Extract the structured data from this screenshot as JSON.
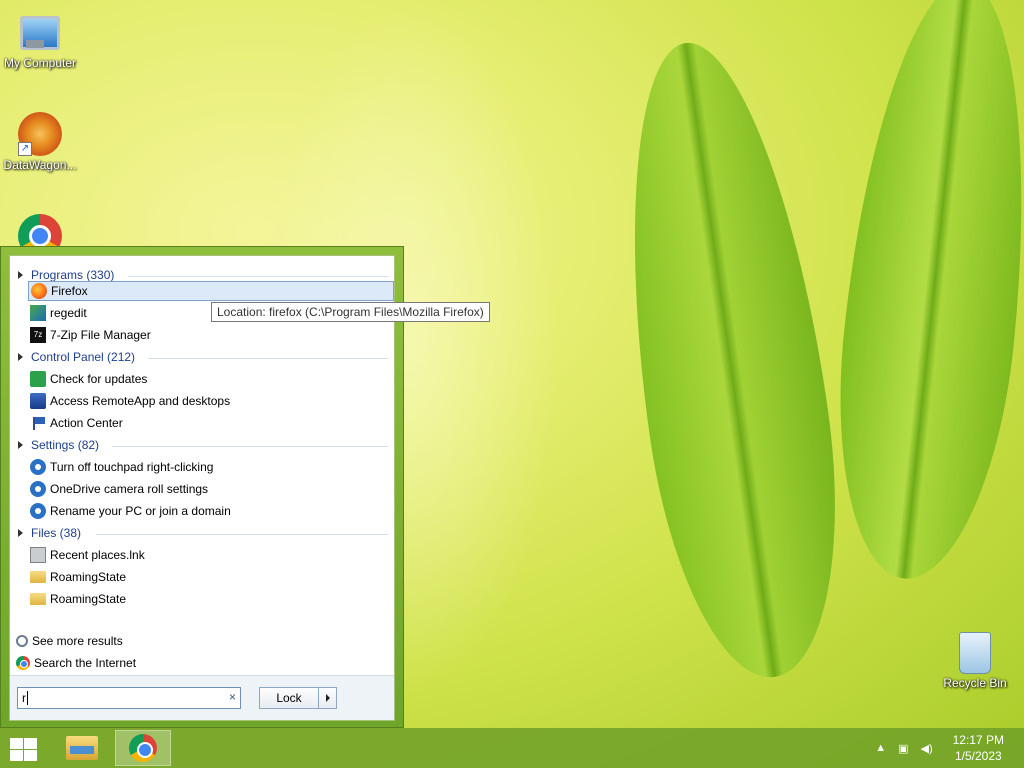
{
  "desktop": {
    "icons": [
      {
        "label": "My Computer"
      },
      {
        "label": "DataWagon..."
      },
      {
        "label": "Recycle Bin"
      }
    ]
  },
  "start_menu": {
    "groups": [
      {
        "label": "Programs (330)",
        "items": [
          "Firefox",
          "regedit",
          "7-Zip File Manager"
        ]
      },
      {
        "label": "Control Panel (212)",
        "items": [
          "Check for updates",
          "Access RemoteApp and desktops",
          "Action Center"
        ]
      },
      {
        "label": "Settings (82)",
        "items": [
          "Turn off touchpad right-clicking",
          "OneDrive camera roll settings",
          "Rename your PC or join a domain"
        ]
      },
      {
        "label": "Files (38)",
        "items": [
          "Recent places.lnk",
          "RoamingState",
          "RoamingState"
        ]
      }
    ],
    "zip_badge": "7z",
    "see_more": "See more results",
    "search_internet": "Search the Internet",
    "search_value": "r",
    "clear_icon": "×",
    "lock_label": "Lock"
  },
  "tooltip": "Location: firefox (C:\\Program Files\\Mozilla Firefox)",
  "taskbar": {
    "time": "12:17 PM",
    "date": "1/5/2023",
    "tray_up": "▲"
  }
}
